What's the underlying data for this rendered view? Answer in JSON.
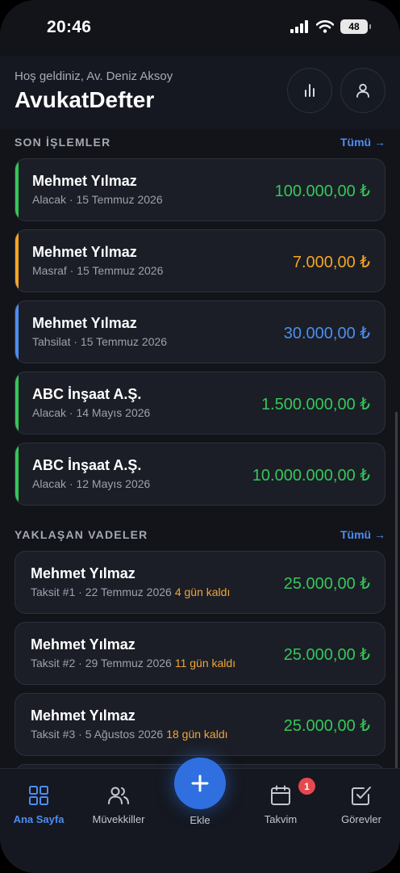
{
  "status_bar": {
    "time": "20:46",
    "battery": "48"
  },
  "header": {
    "greeting": "Hoş geldiniz, Av. Deniz Aksoy",
    "title": "AvukatDefter",
    "stats_icon": "bar-chart-icon",
    "profile_icon": "user-icon"
  },
  "recent": {
    "title": "SON İŞLEMLER",
    "see_all": "Tümü →",
    "items": [
      {
        "name": "Mehmet Yılmaz",
        "sub": "Alacak · 15 Temmuz 2026",
        "amount": "100.000,00 ₺",
        "color": "#34c759"
      },
      {
        "name": "Mehmet Yılmaz",
        "sub": "Masraf · 15 Temmuz 2026",
        "amount": "7.000,00 ₺",
        "color": "#f5a524"
      },
      {
        "name": "Mehmet Yılmaz",
        "sub": "Tahsilat · 15 Temmuz 2026",
        "amount": "30.000,00 ₺",
        "color": "#4d8ef0"
      },
      {
        "name": "ABC İnşaat A.Ş.",
        "sub": "Alacak · 14 Mayıs 2026",
        "amount": "1.500.000,00 ₺",
        "color": "#34c759"
      },
      {
        "name": "ABC İnşaat A.Ş.",
        "sub": "Alacak · 12 Mayıs 2026",
        "amount": "10.000.000,00 ₺",
        "color": "#34c759"
      }
    ]
  },
  "upcoming": {
    "title": "YAKLAŞAN VADELER",
    "see_all": "Tümü →",
    "items": [
      {
        "name": "Mehmet Yılmaz",
        "sub": "Taksit #1 · 22 Temmuz 2026",
        "days": "4 gün kaldı",
        "amount": "25.000,00 ₺"
      },
      {
        "name": "Mehmet Yılmaz",
        "sub": "Taksit #2 · 29 Temmuz 2026",
        "days": "11 gün kaldı",
        "amount": "25.000,00 ₺"
      },
      {
        "name": "Mehmet Yılmaz",
        "sub": "Taksit #3 · 5 Ağustos 2026",
        "days": "18 gün kaldı",
        "amount": "25.000,00 ₺"
      }
    ]
  },
  "tabbar": {
    "tabs": [
      {
        "label": "Ana Sayfa",
        "icon": "grid-icon"
      },
      {
        "label": "Müvekkiller",
        "icon": "users-icon"
      },
      {
        "label": "Ekle",
        "icon": "plus-icon"
      },
      {
        "label": "Takvim",
        "icon": "calendar-icon"
      },
      {
        "label": "Görevler",
        "icon": "checkbox-icon"
      }
    ],
    "calendar_badge": "1"
  },
  "colors": {
    "accent": "#4d8ef0",
    "income": "#34c759",
    "expense": "#f5a524",
    "warning": "#f0a53a",
    "badge": "#e5484d"
  }
}
